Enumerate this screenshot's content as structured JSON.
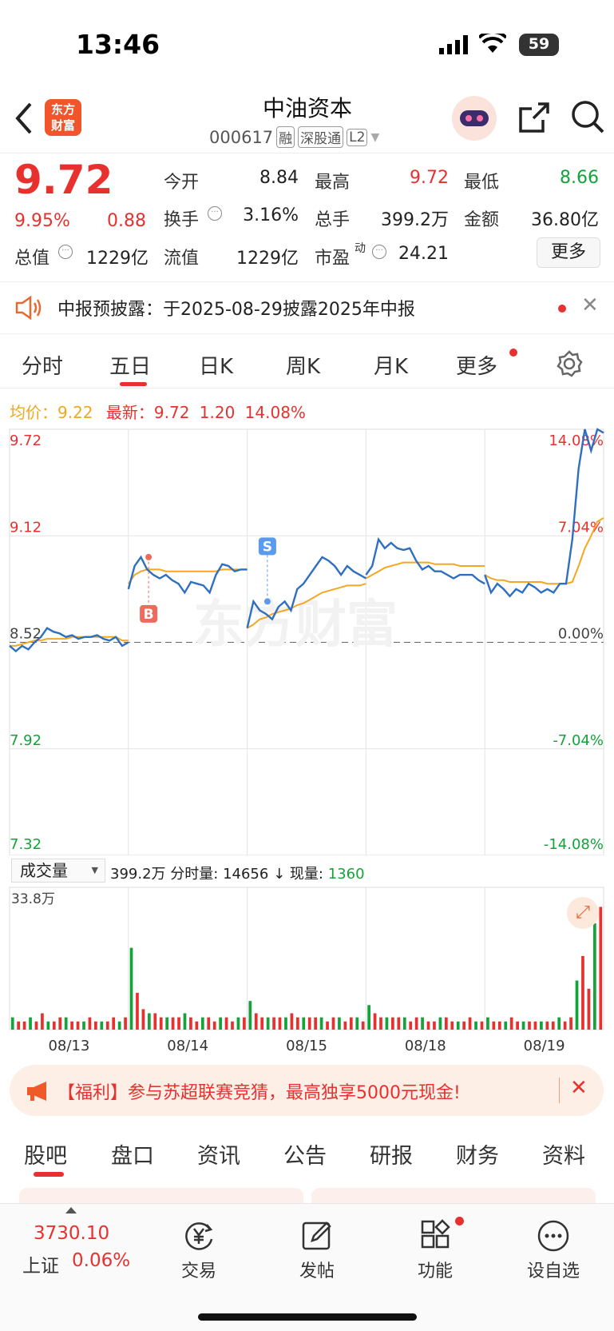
{
  "status_bar": {
    "time": "13:46",
    "battery": "59"
  },
  "header": {
    "title": "中油资本",
    "code": "000617",
    "tags": [
      "融",
      "深股通",
      "L2"
    ],
    "logo_text": "东方财富"
  },
  "quote": {
    "price": "9.72",
    "change_pct": "9.95%",
    "change": "0.88",
    "rows": [
      [
        {
          "label": "今开",
          "value": "8.84",
          "color": "#222"
        },
        {
          "label": "最高",
          "value": "9.72",
          "color": "#e8312f"
        },
        {
          "label": "最低",
          "value": "8.66",
          "color": "#14a33a"
        }
      ],
      [
        {
          "label": "换手",
          "value": "3.16%",
          "color": "#222"
        },
        {
          "label": "总手",
          "value": "399.2万",
          "color": "#222"
        },
        {
          "label": "金额",
          "value": "36.80亿",
          "color": "#222"
        }
      ]
    ],
    "total_value_label": "总值",
    "total_value": "1229亿",
    "float_value_label": "流值",
    "float_value": "1229亿",
    "pe_label": "市盈",
    "pe_sup": "动",
    "pe": "24.21",
    "more_button": "更多"
  },
  "notice": {
    "text": "中报预披露：于2025-08-29披露2025年中报"
  },
  "tabs": [
    "分时",
    "五日",
    "日K",
    "周K",
    "月K",
    "更多"
  ],
  "active_tab": 1,
  "chart_header": {
    "avg_label": "均价：",
    "avg": "9.22",
    "latest_label": "最新：",
    "latest": "9.72",
    "change": "1.20",
    "pct": "14.08%"
  },
  "chart_data": {
    "type": "line",
    "y_left_ticks": [
      "9.72",
      "9.12",
      "8.52",
      "7.92",
      "7.32"
    ],
    "y_right_ticks": [
      "14.08%",
      "7.04%",
      "0.00%",
      "-7.04%",
      "-14.08%"
    ],
    "ylim": [
      7.32,
      9.72
    ],
    "prev_close": 8.52,
    "x_dates": [
      "08/13",
      "08/14",
      "08/15",
      "08/18",
      "08/19"
    ],
    "markers": [
      {
        "label": "B",
        "day": 1,
        "price": 9.0
      },
      {
        "label": "S",
        "day": 2,
        "price": 8.75
      }
    ],
    "series": [
      {
        "values": [
          8.5,
          8.47,
          8.5,
          8.48,
          8.52,
          8.55,
          8.6,
          8.58,
          8.57,
          8.55,
          8.56,
          8.54,
          8.55,
          8.55,
          8.56,
          8.54,
          8.53,
          8.55,
          8.5,
          8.52
        ]
      },
      {
        "values": [
          8.82,
          8.95,
          9.0,
          8.93,
          8.9,
          8.88,
          8.9,
          8.87,
          8.85,
          8.8,
          8.86,
          8.85,
          8.84,
          8.8,
          8.9,
          8.96,
          8.95,
          8.92,
          8.93,
          8.93
        ]
      },
      {
        "values": [
          8.6,
          8.75,
          8.7,
          8.68,
          8.65,
          8.72,
          8.75,
          8.7,
          8.82,
          8.85,
          8.9,
          8.95,
          9.0,
          8.98,
          8.95,
          8.9,
          8.95,
          8.92,
          8.9,
          8.88
        ]
      },
      {
        "values": [
          8.9,
          8.95,
          9.1,
          9.05,
          9.08,
          9.05,
          9.04,
          9.05,
          8.98,
          8.93,
          8.95,
          8.92,
          8.92,
          8.9,
          8.88,
          8.9,
          8.9,
          8.9,
          8.87,
          8.85
        ]
      },
      {
        "values": [
          8.9,
          8.8,
          8.85,
          8.82,
          8.78,
          8.82,
          8.8,
          8.85,
          8.83,
          8.8,
          8.82,
          8.8,
          8.85,
          8.85,
          9.1,
          9.5,
          9.72,
          9.6,
          9.72,
          9.7
        ]
      }
    ],
    "avg_series": [
      {
        "values": [
          8.5,
          8.5,
          8.51,
          8.52,
          8.53,
          8.53,
          8.54,
          8.54,
          8.54,
          8.54,
          8.55,
          8.55,
          8.55,
          8.55,
          8.55,
          8.55,
          8.55,
          8.55,
          8.53,
          8.53
        ]
      },
      {
        "values": [
          8.85,
          8.9,
          8.92,
          8.93,
          8.93,
          8.93,
          8.92,
          8.92,
          8.92,
          8.92,
          8.92,
          8.92,
          8.92,
          8.92,
          8.92,
          8.93,
          8.93,
          8.93,
          8.93,
          8.93
        ]
      },
      {
        "values": [
          8.6,
          8.62,
          8.65,
          8.66,
          8.68,
          8.69,
          8.7,
          8.71,
          8.73,
          8.74,
          8.76,
          8.78,
          8.8,
          8.81,
          8.82,
          8.83,
          8.84,
          8.84,
          8.84,
          8.85
        ]
      },
      {
        "values": [
          8.88,
          8.9,
          8.92,
          8.94,
          8.95,
          8.96,
          8.97,
          8.97,
          8.97,
          8.97,
          8.97,
          8.96,
          8.96,
          8.96,
          8.96,
          8.95,
          8.95,
          8.95,
          8.95,
          8.95
        ]
      },
      {
        "values": [
          8.9,
          8.88,
          8.87,
          8.87,
          8.86,
          8.86,
          8.86,
          8.86,
          8.86,
          8.86,
          8.85,
          8.85,
          8.85,
          8.85,
          8.86,
          8.95,
          9.05,
          9.12,
          9.2,
          9.22
        ]
      }
    ]
  },
  "volume": {
    "selector": "成交量",
    "total": "399.2万",
    "fen_label": "分时量:",
    "fen_value": "14656",
    "arrow": "↓",
    "now_label": "现量:",
    "now_value": "1360",
    "max_label": "33.8万",
    "bars": [
      [
        3,
        2,
        2,
        3,
        2,
        4,
        2,
        2,
        3,
        3,
        2,
        2,
        2,
        3,
        2,
        2,
        2,
        3,
        2,
        3
      ],
      [
        20,
        9,
        5,
        4,
        4,
        3,
        3,
        3,
        3,
        4,
        3,
        2,
        3,
        3,
        2,
        3,
        3,
        2,
        3,
        3
      ],
      [
        7,
        4,
        3,
        3,
        3,
        3,
        3,
        4,
        3,
        3,
        3,
        3,
        3,
        2,
        3,
        3,
        2,
        3,
        3,
        2
      ],
      [
        6,
        4,
        3,
        3,
        3,
        3,
        3,
        2,
        3,
        3,
        2,
        2,
        3,
        3,
        2,
        2,
        2,
        3,
        2,
        2
      ],
      [
        3,
        2,
        2,
        2,
        3,
        2,
        2,
        2,
        2,
        2,
        2,
        2,
        3,
        2,
        3,
        12,
        18,
        10,
        26,
        30
      ]
    ]
  },
  "promo": {
    "text": "【福利】参与苏超联赛竞猜，最高独享5000元现金!"
  },
  "subtabs": [
    "股吧",
    "盘口",
    "资讯",
    "公告",
    "研报",
    "财务",
    "资料"
  ],
  "index": {
    "value": "3730.10",
    "name": "上证",
    "pct": "0.06%"
  },
  "nav": [
    "交易",
    "发帖",
    "功能",
    "设自选"
  ],
  "colors": {
    "accent": "#e8312f",
    "up": "#e8312f",
    "down": "#14a33a",
    "avg": "#f5a623",
    "line": "#2f6fc1"
  }
}
